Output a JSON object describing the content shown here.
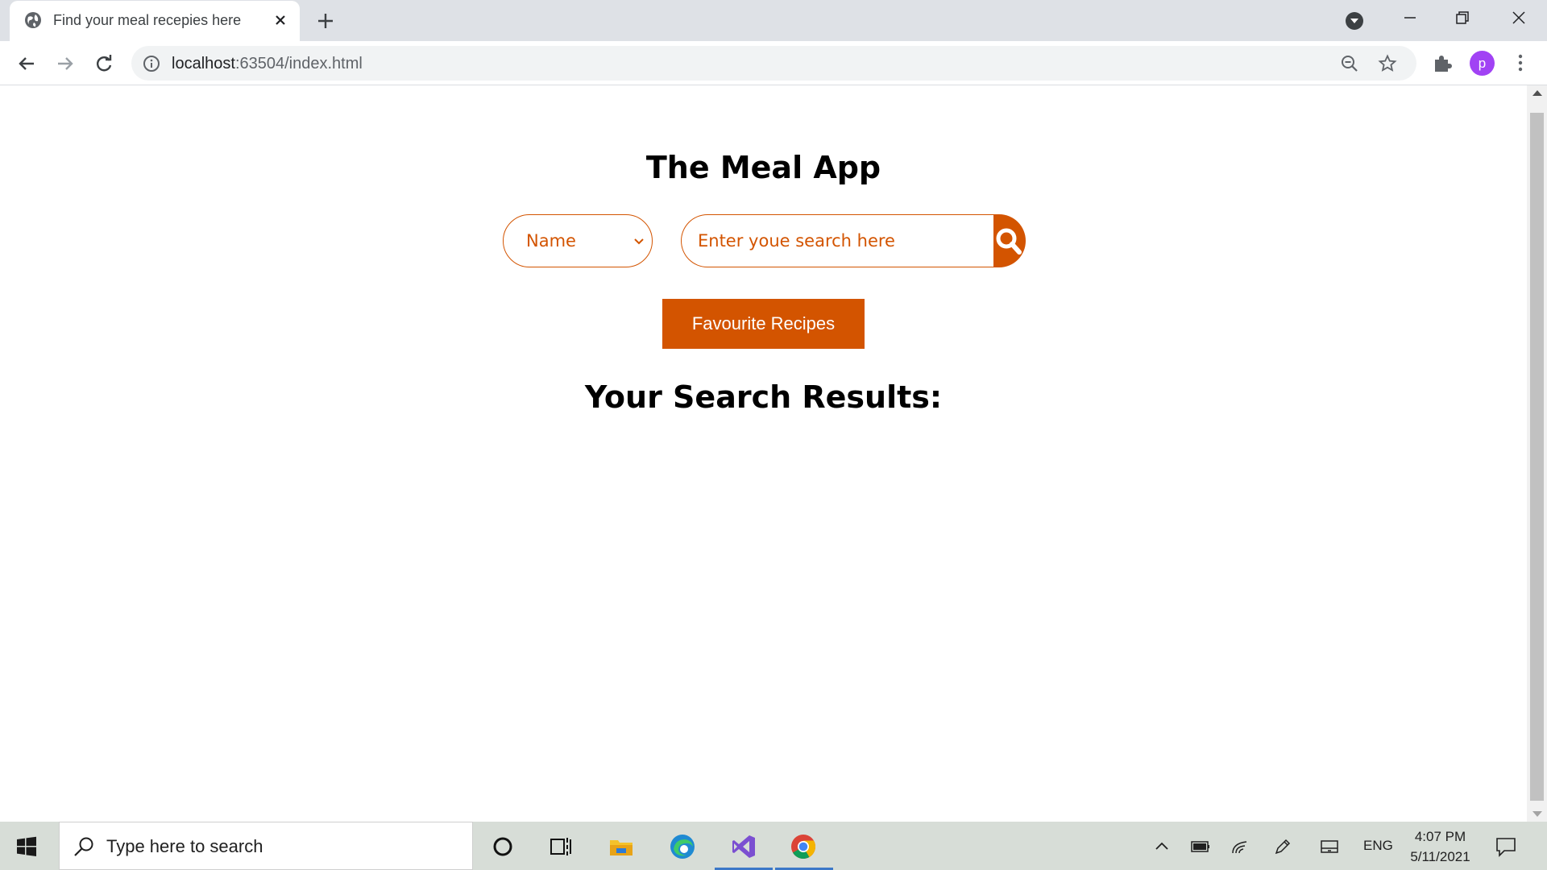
{
  "browser": {
    "tab_title": "Find your meal recepies here",
    "url_host": "localhost",
    "url_rest": ":63504/index.html",
    "profile_initial": "p"
  },
  "page": {
    "app_title": "The Meal App",
    "search_type_selected": "Name",
    "search_placeholder": "Enter youe search here",
    "favourite_button_label": "Favourite Recipes",
    "results_heading": "Your Search Results:",
    "accent_color": "#d35400"
  },
  "taskbar": {
    "search_placeholder": "Type here to search",
    "language": "ENG",
    "time": "4:07 PM",
    "date": "5/11/2021"
  },
  "icons": {
    "tab": [
      "globe-icon",
      "close-icon",
      "plus-icon",
      "tab-search-icon"
    ],
    "toolbar": [
      "back-arrow-icon",
      "forward-arrow-icon",
      "reload-icon",
      "info-icon",
      "zoom-out-icon",
      "star-icon",
      "puzzle-icon",
      "kebab-menu-icon"
    ],
    "taskbar": [
      "windows-logo-icon",
      "search-icon",
      "cortana-icon",
      "task-view-icon",
      "file-explorer-icon",
      "edge-icon",
      "visual-studio-icon",
      "chrome-icon",
      "chevron-up-icon",
      "battery-icon",
      "wifi-icon",
      "pen-icon",
      "keyboard-icon",
      "notification-icon"
    ]
  }
}
